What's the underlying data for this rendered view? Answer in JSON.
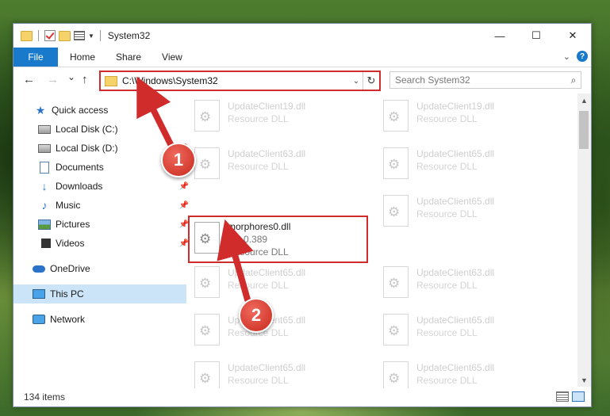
{
  "window": {
    "title": "System32",
    "controls": {
      "minimize": "—",
      "maximize": "☐",
      "close": "✕"
    }
  },
  "ribbon": {
    "tabs": [
      "File",
      "Home",
      "Share",
      "View"
    ],
    "collapse_icon": "chevron-down-icon",
    "help_icon": "?"
  },
  "nav": {
    "back_icon": "←",
    "forward_icon": "→",
    "recent_icon": "⌄",
    "up_icon": "↑",
    "address": "C:\\Windows\\System32",
    "search_placeholder": "Search System32"
  },
  "sidebar": {
    "items": [
      {
        "label": "Quick access",
        "icon": "star-icon"
      },
      {
        "label": "Local Disk (C:)",
        "icon": "disk-icon"
      },
      {
        "label": "Local Disk (D:)",
        "icon": "disk-icon",
        "pinned": true
      },
      {
        "label": "Documents",
        "icon": "documents-icon",
        "pinned": true
      },
      {
        "label": "Downloads",
        "icon": "downloads-icon",
        "pinned": true
      },
      {
        "label": "Music",
        "icon": "music-icon",
        "pinned": true
      },
      {
        "label": "Pictures",
        "icon": "pictures-icon",
        "pinned": true
      },
      {
        "label": "Videos",
        "icon": "videos-icon",
        "pinned": true
      },
      {
        "label": "OneDrive",
        "icon": "onedrive-icon"
      },
      {
        "label": "This PC",
        "icon": "this-pc-icon",
        "selected": true
      },
      {
        "label": "Network",
        "icon": "network-icon"
      }
    ]
  },
  "files": [
    {
      "name": "UpdateClient19.dll",
      "desc": "Resource DLL"
    },
    {
      "name": "UpdateClient19.dll",
      "desc": "Resource DLL"
    },
    {
      "name": "UpdateClient63.dll",
      "desc": "Resource DLL"
    },
    {
      "name": "UpdateClient65.dll",
      "desc": "Resource DLL"
    },
    {
      "name": "morphores0.dll",
      "version": "6.0.0.389",
      "desc": "Resource DLL",
      "highlighted": true
    },
    {
      "name": "UpdateClient65.dll",
      "desc": "Resource DLL"
    },
    {
      "name": "UpdateClient65.dll",
      "desc": "Resource DLL"
    },
    {
      "name": "UpdateClient63.dll",
      "desc": "Resource DLL"
    },
    {
      "name": "UpdateClient65.dll",
      "desc": "Resource DLL"
    },
    {
      "name": "UpdateClient65.dll",
      "desc": "Resource DLL"
    },
    {
      "name": "UpdateClient65.dll",
      "desc": "Resource DLL"
    },
    {
      "name": "UpdateClient65.dll",
      "desc": "Resource DLL"
    }
  ],
  "status": {
    "count": "134 items"
  },
  "annotations": {
    "step1": "1",
    "step2": "2",
    "color": "#d12c2c"
  }
}
